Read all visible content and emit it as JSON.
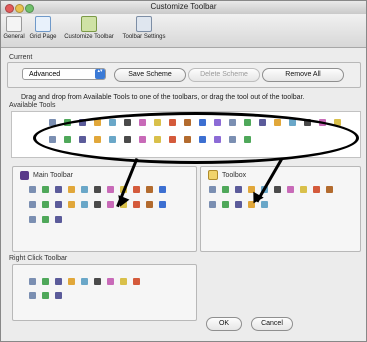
{
  "window": {
    "title": "Customize Toolbar"
  },
  "toolbar": {
    "items": [
      {
        "label": "General",
        "icon": "general-icon"
      },
      {
        "label": "Grid Page",
        "icon": "grid-page-icon"
      },
      {
        "label": "Customize Toolbar",
        "icon": "customize-toolbar-icon"
      },
      {
        "label": "Toolbar Settings",
        "icon": "toolbar-settings-icon"
      }
    ]
  },
  "current": {
    "group_label": "Current",
    "select_value": "Advanced",
    "save_scheme": "Save Scheme",
    "delete_scheme": "Delete Scheme",
    "remove_all": "Remove All"
  },
  "instructions": "Drag and drop from Available Tools to one of the toolbars, or drag the tool out of the toolbar.",
  "available_tools": {
    "label": "Available Tools"
  },
  "main_toolbar": {
    "label": "Main Toolbar"
  },
  "toolbox": {
    "label": "Toolbox"
  },
  "right_click_toolbar": {
    "label": "Right Click Toolbar"
  },
  "buttons": {
    "ok": "OK",
    "cancel": "Cancel"
  },
  "colors": {
    "accent": "#3b7ad6",
    "annotation": "#000000"
  }
}
